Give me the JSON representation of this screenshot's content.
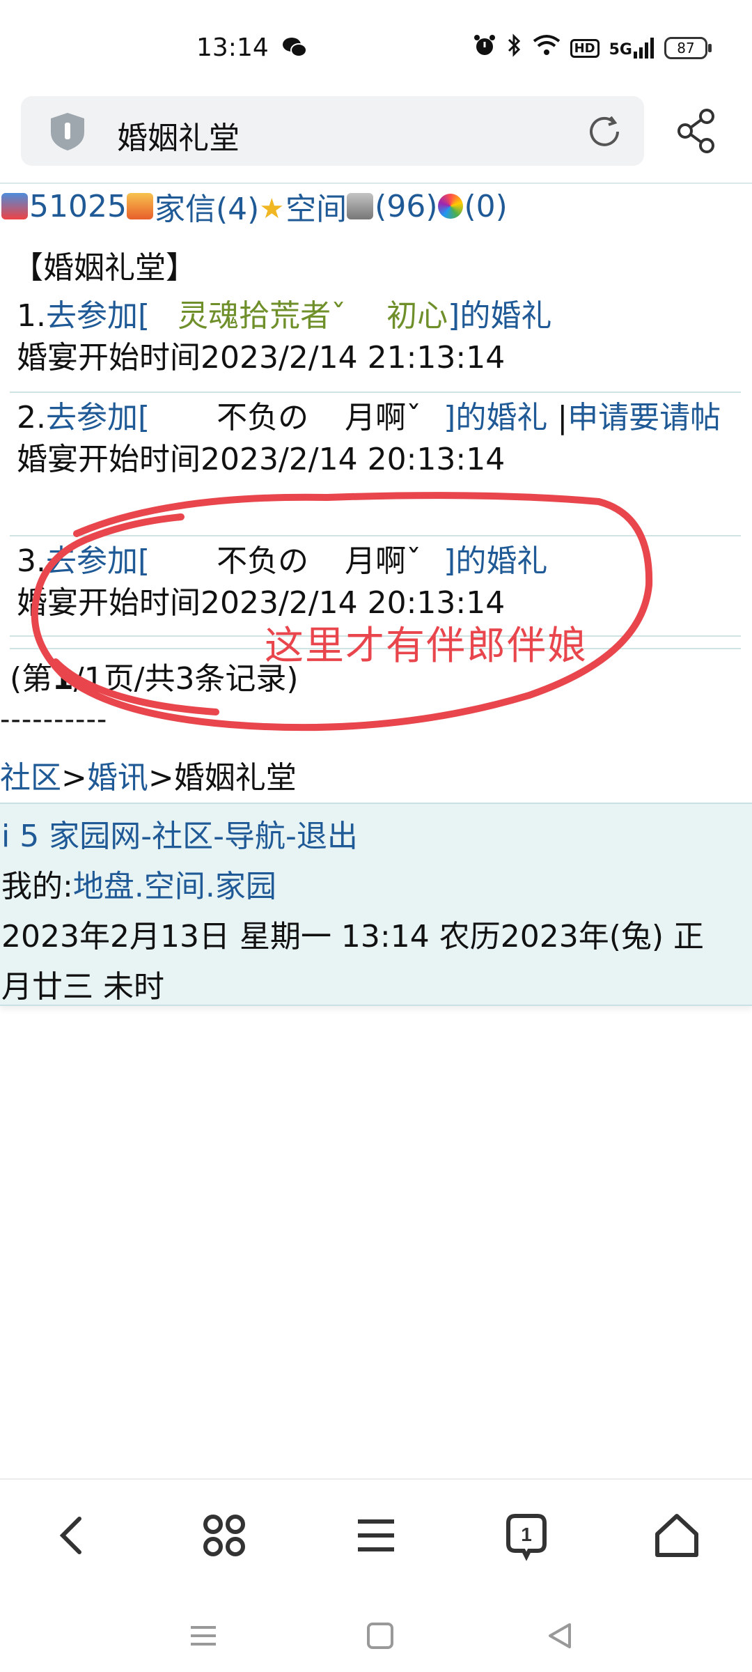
{
  "status_bar": {
    "time": "13:14",
    "battery": "87",
    "network": "5G",
    "hd": "HD"
  },
  "address_bar": {
    "title": "婚姻礼堂"
  },
  "top_links": {
    "user_id": "51025",
    "mail": "家信(4)",
    "space": "空间",
    "bank_count": "(96)",
    "ring_count": "(0)"
  },
  "page_heading": "【婚姻礼堂】",
  "weddings": [
    {
      "index": "1.",
      "link_prefix": "去参加[",
      "name_a": "灵魂拾荒者ˇ",
      "name_b": "初心",
      "link_suffix": "]的婚礼",
      "time_label": "婚宴开始时间2023/2/14 21:13:14"
    },
    {
      "index": "2.",
      "link_prefix": "去参加[",
      "name_a": "不负の",
      "name_b": "月啊ˇ",
      "link_suffix": "]的婚礼",
      "separator": "|",
      "extra_link": "申请要请帖",
      "time_label": "婚宴开始时间2023/2/14 20:13:14"
    },
    {
      "index": "3.",
      "link_prefix": "去参加[",
      "name_a": "不负の",
      "name_b": "月啊ˇ",
      "link_suffix": "]的婚礼",
      "time_label": "婚宴开始时间2023/2/14 20:13:14"
    }
  ],
  "pager": {
    "pre": "(第",
    "current": "1",
    "post": "/1页/共3条记录)"
  },
  "dash_line": "----------",
  "breadcrumb": {
    "community": "社区",
    "sep1": ">",
    "news": "婚讯",
    "sep2": ">",
    "current": "婚姻礼堂"
  },
  "footer": {
    "site": "i 5 家园网",
    "community": "社区",
    "nav": "导航",
    "logout": "退出",
    "dash": "-",
    "mine_label": "我的:",
    "land": "地盘",
    "space": "空间",
    "home": "家园",
    "dot": ".",
    "date_line1": "2023年2月13日  星期一  13:14  农历2023年(兔)  正",
    "date_line2": "月廿三  未时"
  },
  "annotation": {
    "text": "这里才有伴郎伴娘",
    "color": "#e8464c"
  },
  "toolbar": {
    "tab_count": "1"
  }
}
